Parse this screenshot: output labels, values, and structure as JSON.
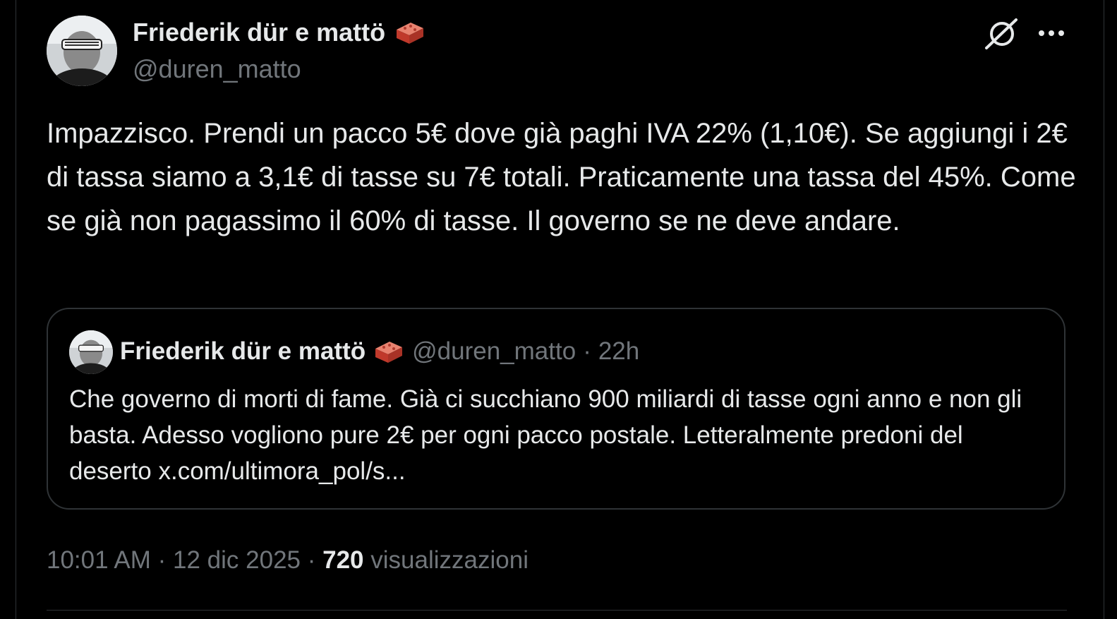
{
  "author": {
    "display_name": "Friederik dür e mattö",
    "handle": "@duren_matto",
    "badge_icon": "brick-icon"
  },
  "header_icons": {
    "grok": "grok-icon",
    "more": "more-icon"
  },
  "tweet": {
    "text": "Impazzisco. Prendi un pacco 5€ dove già paghi IVA 22% (1,10€). Se aggiungi i 2€ di tassa siamo a 3,1€ di tasse su 7€ totali. Praticamente una tassa del 45%. Come se già non pagassimo il 60% di tasse. Il governo se ne deve andare."
  },
  "quoted_tweet": {
    "display_name": "Friederik dür e mattö",
    "handle": "@duren_matto",
    "separator": "·",
    "time_ago": "22h",
    "text": "Che governo di morti di fame. Già ci succhiano 900 miliardi di tasse ogni anno e non gli basta. Adesso vogliono pure 2€ per ogni pacco postale. Letteralmente predoni del deserto x.com/ultimora_pol/s..."
  },
  "footer": {
    "time": "10:01 AM",
    "separator": "·",
    "date": "12 dic 2025",
    "views_count": "720",
    "views_label": "visualizzazioni"
  },
  "colors": {
    "background": "#000000",
    "text_primary": "#e7e9ea",
    "text_secondary": "#71767b",
    "border": "#2f3336"
  }
}
